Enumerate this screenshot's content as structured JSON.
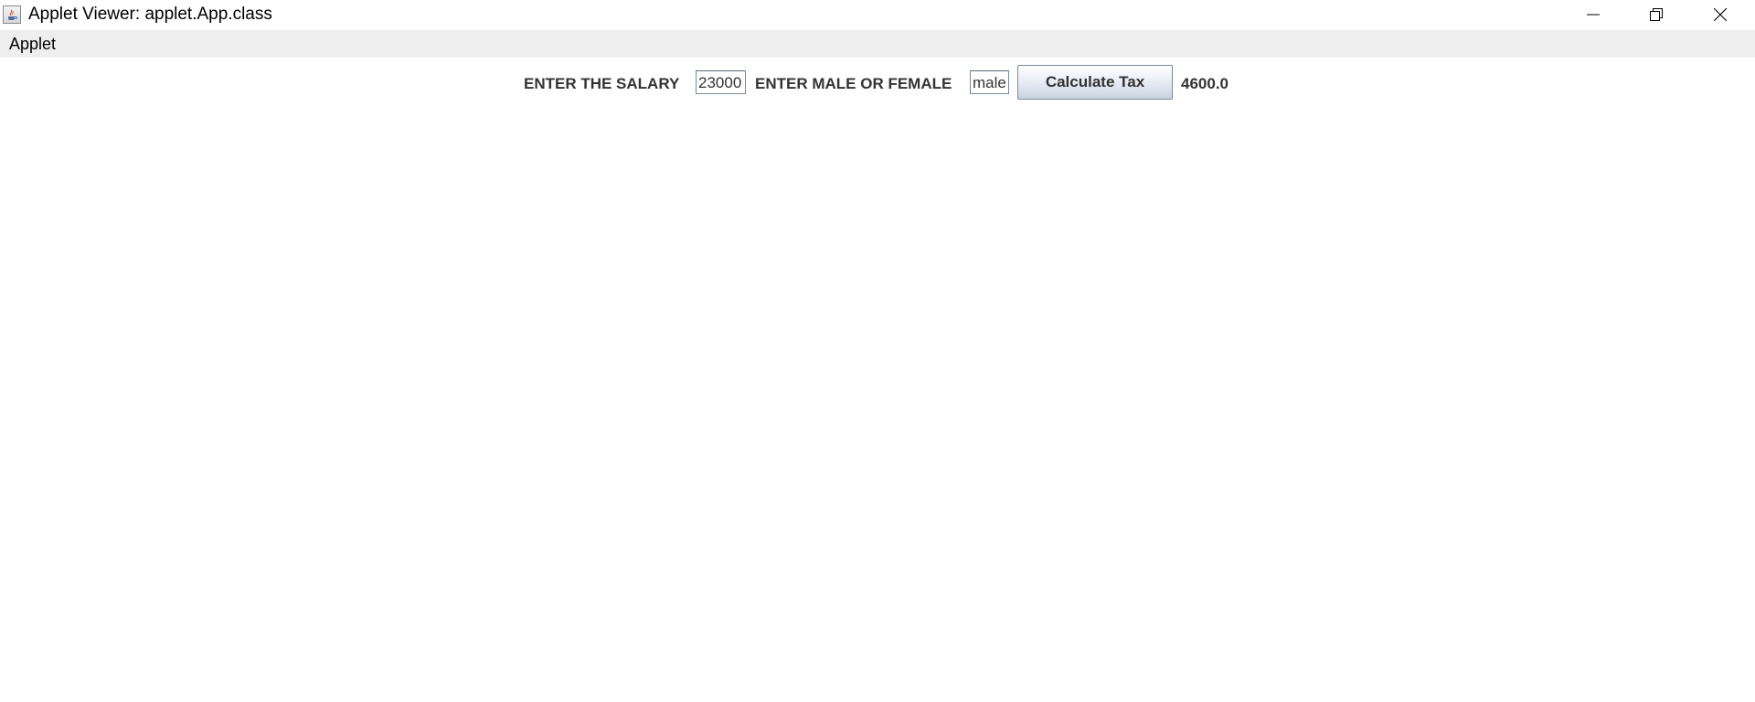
{
  "window": {
    "title": "Applet Viewer: applet.App.class",
    "icon": "java-icon",
    "controls": {
      "minimize_icon": "minimize-icon",
      "maximize_icon": "restore-icon",
      "close_icon": "close-icon"
    }
  },
  "menu": {
    "items": [
      {
        "label": "Applet"
      }
    ]
  },
  "applet": {
    "salary_label": "ENTER THE SALARY",
    "salary_value": "23000",
    "gender_label": "ENTER MALE OR FEMALE",
    "gender_value": "male",
    "calculate_button_label": "Calculate Tax",
    "result": "4600.0"
  },
  "colors": {
    "menubar_background": "#eeeeee",
    "label_text": "#333333",
    "button_gradient_top": "#ffffff",
    "button_gradient_bottom": "#c8d4e2",
    "field_border": "#7a8a99"
  }
}
